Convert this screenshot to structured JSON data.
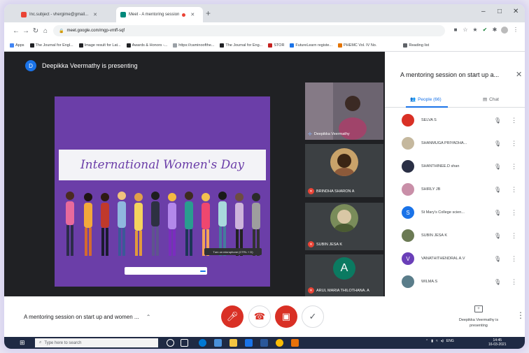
{
  "browser": {
    "tabs": [
      {
        "label": "Inc.subject - vhergime@gmail... "
      },
      {
        "label": "Meet - A mentoring session"
      }
    ],
    "url": "meet.google.com/mgp-vmff-sqf",
    "bookmarks": [
      "Apps",
      "The Journal for Engl...",
      "Image result for Lat...",
      "Awards & Honors -...",
      "https://caminoofthe...",
      "The Journal for Eng...",
      "STOR",
      "FutureLearn registe...",
      "PHEMC Vol. IV No.",
      "Reading list"
    ]
  },
  "stage": {
    "presenting_label": "Deepikka Veermathy is presenting",
    "presenter_initial": "D",
    "slide_title": "International Women's Day",
    "tooltip": "Turn on microphone (CTRL + D)"
  },
  "tiles": [
    {
      "name": "Deepikka Veermathy"
    },
    {
      "name": "BRINDHA SHARON A"
    },
    {
      "name": "SUBIN JESA K"
    },
    {
      "name": "ARUL MARIA THILOTHANA. A",
      "initial": "A"
    }
  ],
  "panel": {
    "title": "A mentoring session on start up a...",
    "people_tab": "People (66)",
    "chat_tab": "Chat",
    "participants": [
      {
        "name": "SELVA S",
        "color": "#d93025"
      },
      {
        "name": "SHANMUGA PRIYADHA...",
        "color": "#c5b89e"
      },
      {
        "name": "SHANTHINEE.D shan",
        "color": "#2a2f45"
      },
      {
        "name": "SHIRLY JB",
        "color": "#c98fa8"
      },
      {
        "name": "St Mary's College scien...",
        "color": "#1a73e8",
        "initial": "S"
      },
      {
        "name": "SUBIN JESA K",
        "color": "#6b7a54"
      },
      {
        "name": "VANATHITHENDRAL A.V",
        "color": "#6a3fb8",
        "initial": "V"
      },
      {
        "name": "WILMA.S",
        "color": "#5a7d8a"
      }
    ]
  },
  "bottom": {
    "meeting_title": "A mentoring session on start up and women ...",
    "present_label": "Deepikka Veermathy is presenting"
  },
  "taskbar": {
    "search_placeholder": "Type here to search",
    "tray": "ENG",
    "time": "14:45",
    "date": "16-03-2021"
  }
}
